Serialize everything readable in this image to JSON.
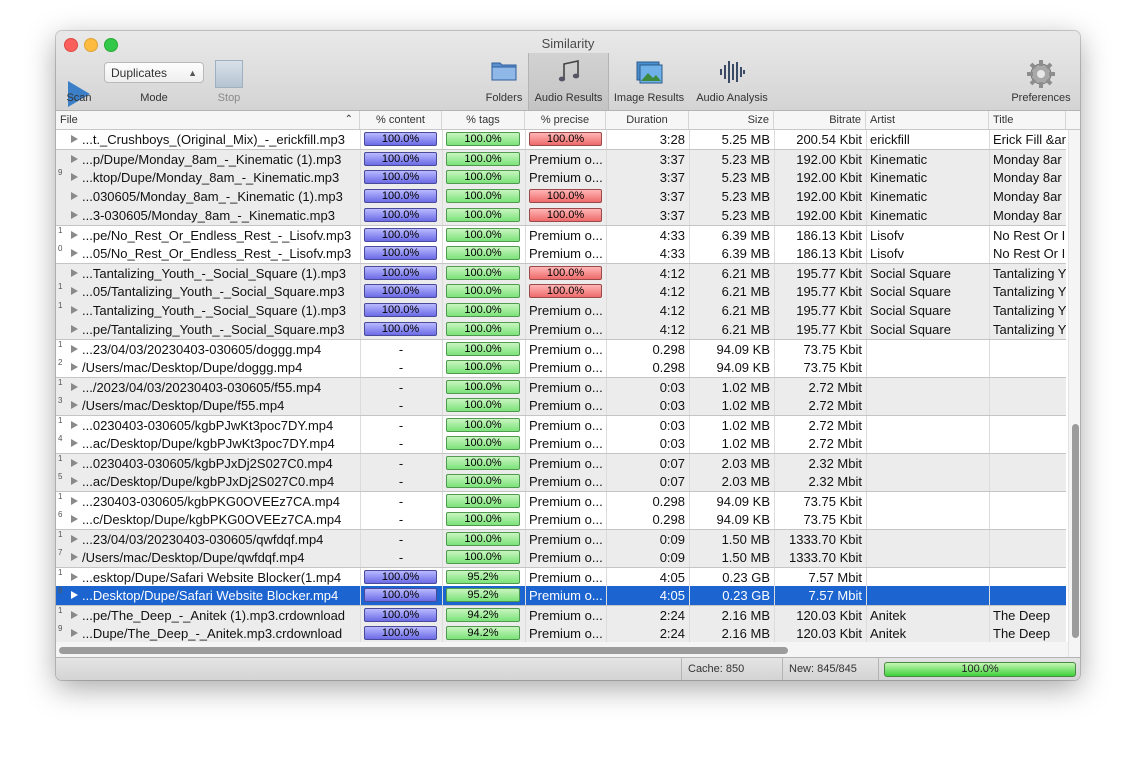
{
  "window": {
    "title": "Similarity"
  },
  "toolbar": {
    "scan_label": "Scan",
    "mode_label": "Mode",
    "mode_value": "Duplicates",
    "stop_label": "Stop",
    "folders_label": "Folders",
    "audio_results_label": "Audio Results",
    "image_results_label": "Image Results",
    "audio_analysis_label": "Audio Analysis",
    "preferences_label": "Preferences"
  },
  "columns": [
    "File",
    "% content",
    "% tags",
    "% precise",
    "Duration",
    "Size",
    "Bitrate",
    "Artist",
    "Title"
  ],
  "rows": [
    {
      "grp": "",
      "file": "...t._Crushboys_(Original_Mix)_-_erickfill.mp3",
      "content": "100.0%",
      "tags": "100.0%",
      "precise": "100.0%",
      "precise_kind": "bar",
      "duration": "3:28",
      "size": "5.25 MB",
      "bitrate": "200.54 Kbit",
      "artist": "erickfill",
      "title": "Erick Fill &ar"
    },
    {
      "grp": "",
      "file": "...p/Dupe/Monday_8am_-_Kinematic (1).mp3",
      "content": "100.0%",
      "tags": "100.0%",
      "precise": "Premium o...",
      "precise_kind": "text",
      "duration": "3:37",
      "size": "5.23 MB",
      "bitrate": "192.00 Kbit",
      "artist": "Kinematic",
      "title": "Monday 8ar"
    },
    {
      "grp": "9",
      "file": "...ktop/Dupe/Monday_8am_-_Kinematic.mp3",
      "content": "100.0%",
      "tags": "100.0%",
      "precise": "Premium o...",
      "precise_kind": "text",
      "duration": "3:37",
      "size": "5.23 MB",
      "bitrate": "192.00 Kbit",
      "artist": "Kinematic",
      "title": "Monday 8ar"
    },
    {
      "grp": "",
      "file": "...030605/Monday_8am_-_Kinematic (1).mp3",
      "content": "100.0%",
      "tags": "100.0%",
      "precise": "100.0%",
      "precise_kind": "bar",
      "duration": "3:37",
      "size": "5.23 MB",
      "bitrate": "192.00 Kbit",
      "artist": "Kinematic",
      "title": "Monday 8ar"
    },
    {
      "grp": "",
      "file": "...3-030605/Monday_8am_-_Kinematic.mp3",
      "content": "100.0%",
      "tags": "100.0%",
      "precise": "100.0%",
      "precise_kind": "bar",
      "duration": "3:37",
      "size": "5.23 MB",
      "bitrate": "192.00 Kbit",
      "artist": "Kinematic",
      "title": "Monday 8ar"
    },
    {
      "grp": "1",
      "file": "...pe/No_Rest_Or_Endless_Rest_-_Lisofv.mp3",
      "content": "100.0%",
      "tags": "100.0%",
      "precise": "Premium o...",
      "precise_kind": "text",
      "duration": "4:33",
      "size": "6.39 MB",
      "bitrate": "186.13 Kbit",
      "artist": "Lisofv",
      "title": "No Rest Or I"
    },
    {
      "grp": "0",
      "file": "...05/No_Rest_Or_Endless_Rest_-_Lisofv.mp3",
      "content": "100.0%",
      "tags": "100.0%",
      "precise": "Premium o...",
      "precise_kind": "text",
      "duration": "4:33",
      "size": "6.39 MB",
      "bitrate": "186.13 Kbit",
      "artist": "Lisofv",
      "title": "No Rest Or I"
    },
    {
      "grp": "",
      "file": "...Tantalizing_Youth_-_Social_Square (1).mp3",
      "content": "100.0%",
      "tags": "100.0%",
      "precise": "100.0%",
      "precise_kind": "bar",
      "duration": "4:12",
      "size": "6.21 MB",
      "bitrate": "195.77 Kbit",
      "artist": "Social Square",
      "title": "Tantalizing Y"
    },
    {
      "grp": "1",
      "file": "...05/Tantalizing_Youth_-_Social_Square.mp3",
      "content": "100.0%",
      "tags": "100.0%",
      "precise": "100.0%",
      "precise_kind": "bar",
      "duration": "4:12",
      "size": "6.21 MB",
      "bitrate": "195.77 Kbit",
      "artist": "Social Square",
      "title": "Tantalizing Y"
    },
    {
      "grp": "1",
      "file": "...Tantalizing_Youth_-_Social_Square (1).mp3",
      "content": "100.0%",
      "tags": "100.0%",
      "precise": "Premium o...",
      "precise_kind": "text",
      "duration": "4:12",
      "size": "6.21 MB",
      "bitrate": "195.77 Kbit",
      "artist": "Social Square",
      "title": "Tantalizing Y"
    },
    {
      "grp": "",
      "file": "...pe/Tantalizing_Youth_-_Social_Square.mp3",
      "content": "100.0%",
      "tags": "100.0%",
      "precise": "Premium o...",
      "precise_kind": "text",
      "duration": "4:12",
      "size": "6.21 MB",
      "bitrate": "195.77 Kbit",
      "artist": "Social Square",
      "title": "Tantalizing Y"
    },
    {
      "grp": "1",
      "file": "...23/04/03/20230403-030605/doggg.mp4",
      "content": "-",
      "tags": "100.0%",
      "precise": "Premium o...",
      "precise_kind": "text",
      "duration": "0.298",
      "size": "94.09 KB",
      "bitrate": "73.75 Kbit",
      "artist": "",
      "title": ""
    },
    {
      "grp": "2",
      "file": "/Users/mac/Desktop/Dupe/doggg.mp4",
      "content": "-",
      "tags": "100.0%",
      "precise": "Premium o...",
      "precise_kind": "text",
      "duration": "0.298",
      "size": "94.09 KB",
      "bitrate": "73.75 Kbit",
      "artist": "",
      "title": ""
    },
    {
      "grp": "1",
      "file": ".../2023/04/03/20230403-030605/f55.mp4",
      "content": "-",
      "tags": "100.0%",
      "precise": "Premium o...",
      "precise_kind": "text",
      "duration": "0:03",
      "size": "1.02 MB",
      "bitrate": "2.72 Mbit",
      "artist": "",
      "title": ""
    },
    {
      "grp": "3",
      "file": "/Users/mac/Desktop/Dupe/f55.mp4",
      "content": "-",
      "tags": "100.0%",
      "precise": "Premium o...",
      "precise_kind": "text",
      "duration": "0:03",
      "size": "1.02 MB",
      "bitrate": "2.72 Mbit",
      "artist": "",
      "title": ""
    },
    {
      "grp": "1",
      "file": "...0230403-030605/kgbPJwKt3poc7DY.mp4",
      "content": "-",
      "tags": "100.0%",
      "precise": "Premium o...",
      "precise_kind": "text",
      "duration": "0:03",
      "size": "1.02 MB",
      "bitrate": "2.72 Mbit",
      "artist": "",
      "title": ""
    },
    {
      "grp": "4",
      "file": "...ac/Desktop/Dupe/kgbPJwKt3poc7DY.mp4",
      "content": "-",
      "tags": "100.0%",
      "precise": "Premium o...",
      "precise_kind": "text",
      "duration": "0:03",
      "size": "1.02 MB",
      "bitrate": "2.72 Mbit",
      "artist": "",
      "title": ""
    },
    {
      "grp": "1",
      "file": "...0230403-030605/kgbPJxDj2S027C0.mp4",
      "content": "-",
      "tags": "100.0%",
      "precise": "Premium o...",
      "precise_kind": "text",
      "duration": "0:07",
      "size": "2.03 MB",
      "bitrate": "2.32 Mbit",
      "artist": "",
      "title": ""
    },
    {
      "grp": "5",
      "file": "...ac/Desktop/Dupe/kgbPJxDj2S027C0.mp4",
      "content": "-",
      "tags": "100.0%",
      "precise": "Premium o...",
      "precise_kind": "text",
      "duration": "0:07",
      "size": "2.03 MB",
      "bitrate": "2.32 Mbit",
      "artist": "",
      "title": ""
    },
    {
      "grp": "1",
      "file": "...230403-030605/kgbPKG0OVEEz7CA.mp4",
      "content": "-",
      "tags": "100.0%",
      "precise": "Premium o...",
      "precise_kind": "text",
      "duration": "0.298",
      "size": "94.09 KB",
      "bitrate": "73.75 Kbit",
      "artist": "",
      "title": ""
    },
    {
      "grp": "6",
      "file": "...c/Desktop/Dupe/kgbPKG0OVEEz7CA.mp4",
      "content": "-",
      "tags": "100.0%",
      "precise": "Premium o...",
      "precise_kind": "text",
      "duration": "0.298",
      "size": "94.09 KB",
      "bitrate": "73.75 Kbit",
      "artist": "",
      "title": ""
    },
    {
      "grp": "1",
      "file": "...23/04/03/20230403-030605/qwfdqf.mp4",
      "content": "-",
      "tags": "100.0%",
      "precise": "Premium o...",
      "precise_kind": "text",
      "duration": "0:09",
      "size": "1.50 MB",
      "bitrate": "1333.70 Kbit",
      "artist": "",
      "title": ""
    },
    {
      "grp": "7",
      "file": "/Users/mac/Desktop/Dupe/qwfdqf.mp4",
      "content": "-",
      "tags": "100.0%",
      "precise": "Premium o...",
      "precise_kind": "text",
      "duration": "0:09",
      "size": "1.50 MB",
      "bitrate": "1333.70 Kbit",
      "artist": "",
      "title": ""
    },
    {
      "grp": "1",
      "file": "...esktop/Dupe/Safari Website Blocker(1.mp4",
      "content": "100.0%",
      "tags": "95.2%",
      "precise": "Premium o...",
      "precise_kind": "text",
      "duration": "4:05",
      "size": "0.23 GB",
      "bitrate": "7.57 Mbit",
      "artist": "",
      "title": ""
    },
    {
      "grp": "8",
      "file": "...Desktop/Dupe/Safari Website Blocker.mp4",
      "content": "100.0%",
      "tags": "95.2%",
      "precise": "Premium o...",
      "precise_kind": "text",
      "duration": "4:05",
      "size": "0.23 GB",
      "bitrate": "7.57 Mbit",
      "artist": "",
      "title": ""
    },
    {
      "grp": "1",
      "file": "...pe/The_Deep_-_Anitek (1).mp3.crdownload",
      "content": "100.0%",
      "tags": "94.2%",
      "precise": "Premium o...",
      "precise_kind": "text",
      "duration": "2:24",
      "size": "2.16 MB",
      "bitrate": "120.03 Kbit",
      "artist": "Anitek",
      "title": "The Deep"
    },
    {
      "grp": "9",
      "file": "...Dupe/The_Deep_-_Anitek.mp3.crdownload",
      "content": "100.0%",
      "tags": "94.2%",
      "precise": "Premium o...",
      "precise_kind": "text",
      "duration": "2:24",
      "size": "2.16 MB",
      "bitrate": "120.03 Kbit",
      "artist": "Anitek",
      "title": "The Deep"
    }
  ],
  "selected_row": 24,
  "status": {
    "cache": "Cache: 850",
    "new": "New: 845/845",
    "progress_text": "100.0%",
    "progress": 1.0
  },
  "colors": {
    "selection": "#1c64d0",
    "content_bar": "#6b6be6",
    "tags_bar": "#7ce37a",
    "precise_bar": "#ee6a6a"
  }
}
